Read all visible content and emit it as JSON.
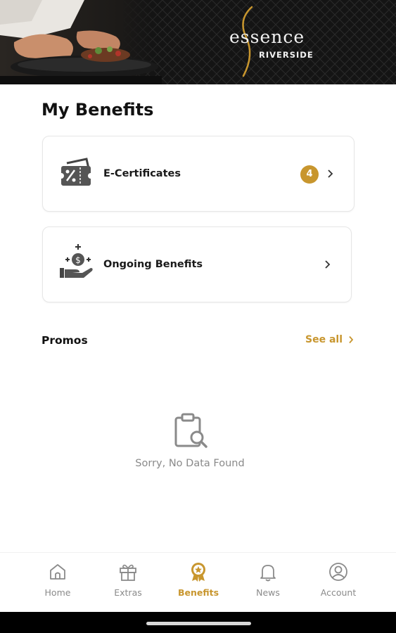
{
  "header": {
    "brand_script": "essence",
    "brand_sub": "RIVERSIDE"
  },
  "page_title": "My Benefits",
  "cards": [
    {
      "label": "E-Certificates",
      "badge": "4",
      "icon": "voucher-percent-icon"
    },
    {
      "label": "Ongoing Benefits",
      "icon": "coin-hand-icon"
    }
  ],
  "promos": {
    "title": "Promos",
    "see_all": "See all",
    "empty_message": "Sorry, No Data Found"
  },
  "nav": [
    {
      "label": "Home",
      "icon": "home-icon",
      "active": false
    },
    {
      "label": "Extras",
      "icon": "gift-icon",
      "active": false
    },
    {
      "label": "Benefits",
      "icon": "award-badge-icon",
      "active": true
    },
    {
      "label": "News",
      "icon": "bell-icon",
      "active": false
    },
    {
      "label": "Account",
      "icon": "user-circle-icon",
      "active": false
    }
  ],
  "colors": {
    "accent": "#c8962e",
    "banner_bg": "#141414",
    "muted_text": "#8a8a8a"
  }
}
